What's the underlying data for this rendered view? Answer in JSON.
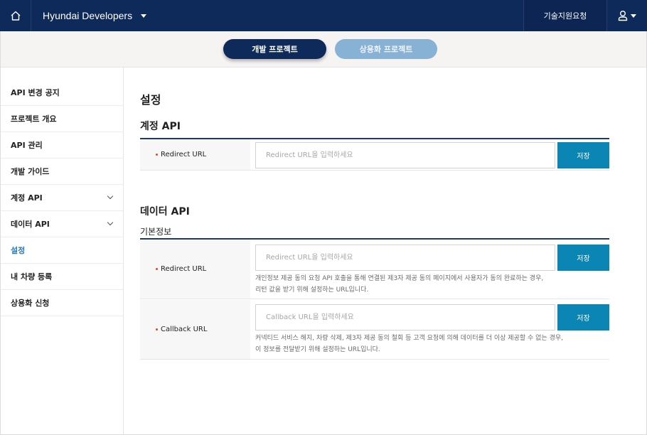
{
  "header": {
    "home_icon": "home-icon",
    "brand": "Hyundai Developers",
    "brand_caret_icon": "caret-down-icon",
    "support_label": "기술지원요청",
    "user_icon": "user-icon",
    "user_caret_icon": "caret-down-icon"
  },
  "project_tabs": [
    {
      "label": "개발 프로젝트",
      "active": true
    },
    {
      "label": "상용화 프로젝트",
      "active": false
    }
  ],
  "sidebar": {
    "items": [
      {
        "label": "API 변경 공지",
        "expandable": false,
        "active": false
      },
      {
        "label": "프로젝트 개요",
        "expandable": false,
        "active": false
      },
      {
        "label": "API 관리",
        "expandable": false,
        "active": false
      },
      {
        "label": "개발 가이드",
        "expandable": false,
        "active": false
      },
      {
        "label": "계정 API",
        "expandable": true,
        "active": false
      },
      {
        "label": "데이터 API",
        "expandable": true,
        "active": false
      },
      {
        "label": "설정",
        "expandable": false,
        "active": true
      },
      {
        "label": "내 차량 등록",
        "expandable": false,
        "active": false
      },
      {
        "label": "상용화 신청",
        "expandable": false,
        "active": false
      }
    ]
  },
  "main": {
    "page_title": "설정",
    "account_api": {
      "title": "계정 API",
      "redirect": {
        "label": "Redirect URL",
        "value": "",
        "placeholder": "Redirect URL을 입력하세요",
        "save_label": "저장"
      }
    },
    "data_api": {
      "title": "데이터 API",
      "subtitle": "기본정보",
      "redirect": {
        "label": "Redirect URL",
        "value": "",
        "placeholder": "Redirect URL을 입력하세요",
        "save_label": "저장",
        "help_line1": "개인정보 제공 동의 요청 API 호출을 통해 연결된 제3자 제공 동의 페이지에서 사용자가 동의 완료하는 경우,",
        "help_line2": "리턴 값을 받기 위해 설정하는 URL입니다."
      },
      "callback": {
        "label": "Callback URL",
        "value": "",
        "placeholder": "Callback URL을 입력하세요",
        "save_label": "저장",
        "help_line1": "커넥티드 서비스 해지, 차량 삭제, 제3자 제공 동의 철회 등 고객 요청에 의해 데이터를 더 이상 제공할 수 없는 경우,",
        "help_line2": "이 정보를 전달받기 위해 설정하는 URL입니다."
      }
    }
  },
  "colors": {
    "header_bg": "#0e2a5a",
    "active_pill": "#0e2a5a",
    "inactive_pill": "#88b1d6",
    "save_button": "#0a85b4",
    "active_sidebar_text": "#2a7bb0",
    "required_dot": "#e8412f"
  }
}
